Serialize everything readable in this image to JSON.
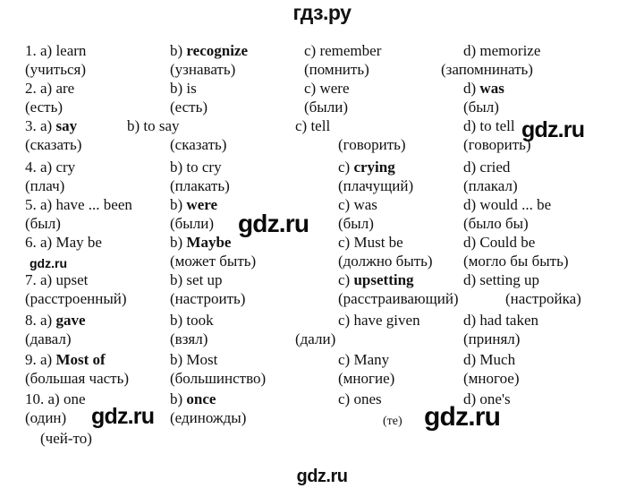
{
  "site": {
    "header_logo": "гдз.ру",
    "footer_logo": "gdz.ru",
    "watermarks": [
      {
        "id": "wm-a",
        "text": "gdz.ru"
      },
      {
        "id": "wm-b",
        "text": "gdz.ru"
      },
      {
        "id": "wm-c",
        "text": "gdz.ru"
      },
      {
        "id": "wm-d",
        "text": "gdz.ru"
      },
      {
        "id": "wm-e",
        "text": "gdz.ru"
      }
    ]
  },
  "exercise": {
    "items": [
      {
        "number": "1.",
        "options": [
          {
            "letter": "a)",
            "word": "learn",
            "bold": false,
            "translation": "(учиться)"
          },
          {
            "letter": "b)",
            "word": "recognize",
            "bold": true,
            "translation": "(узнавать)"
          },
          {
            "letter": "c)",
            "word": "remember",
            "bold": false,
            "translation": "(помнить)"
          },
          {
            "letter": "d)",
            "word": "memorize",
            "bold": false,
            "translation": "(запомнинать)"
          }
        ]
      },
      {
        "number": "2.",
        "options": [
          {
            "letter": "a)",
            "word": "are",
            "bold": false,
            "translation": "(есть)"
          },
          {
            "letter": "b)",
            "word": "is",
            "bold": false,
            "translation": "(есть)"
          },
          {
            "letter": "c)",
            "word": "were",
            "bold": false,
            "translation": "(были)"
          },
          {
            "letter": "d)",
            "word": "was",
            "bold": true,
            "translation": "(был)"
          }
        ]
      },
      {
        "number": "3.",
        "options": [
          {
            "letter": "a)",
            "word": "say",
            "bold": true,
            "translation": "(сказать)"
          },
          {
            "letter": "b)",
            "word": "to say",
            "bold": false,
            "translation": "(сказать)"
          },
          {
            "letter": "c)",
            "word": "tell",
            "bold": false,
            "translation": "(говорить)"
          },
          {
            "letter": "d)",
            "word": "to tell",
            "bold": false,
            "translation": "(говорить)"
          }
        ]
      },
      {
        "number": "4.",
        "options": [
          {
            "letter": "a)",
            "word": "cry",
            "bold": false,
            "translation": "(плач)"
          },
          {
            "letter": "b)",
            "word": "to cry",
            "bold": false,
            "translation": "(плакать)"
          },
          {
            "letter": "c)",
            "word": "crying",
            "bold": true,
            "translation": "(плачущий)"
          },
          {
            "letter": "d)",
            "word": "cried",
            "bold": false,
            "translation": "(плакал)"
          }
        ]
      },
      {
        "number": "5.",
        "options": [
          {
            "letter": "a)",
            "word": "have ... been",
            "bold": false,
            "translation": "(был)"
          },
          {
            "letter": "b)",
            "word": "were",
            "bold": true,
            "translation": "(были)"
          },
          {
            "letter": "c)",
            "word": "was",
            "bold": false,
            "translation": "(был)"
          },
          {
            "letter": "d)",
            "word": "would ... be",
            "bold": false,
            "translation": "(было бы)"
          }
        ]
      },
      {
        "number": "6.",
        "options": [
          {
            "letter": "a)",
            "word": "May be",
            "bold": false,
            "translation": ""
          },
          {
            "letter": "b)",
            "word": "Maybe",
            "bold": true,
            "translation": "(может быть)"
          },
          {
            "letter": "c)",
            "word": "Must be",
            "bold": false,
            "translation": "(должно быть)"
          },
          {
            "letter": "d)",
            "word": "Could be",
            "bold": false,
            "translation": "(могло бы быть)"
          }
        ]
      },
      {
        "number": "7.",
        "options": [
          {
            "letter": "a)",
            "word": "upset",
            "bold": false,
            "translation": "(расстроенный)"
          },
          {
            "letter": "b)",
            "word": "set up",
            "bold": false,
            "translation": "(настроить)"
          },
          {
            "letter": "c)",
            "word": "upsetting",
            "bold": true,
            "translation": "(расстраивающий)"
          },
          {
            "letter": "d)",
            "word": "setting up",
            "bold": false,
            "translation": "(настройка)"
          }
        ]
      },
      {
        "number": "8.",
        "options": [
          {
            "letter": "a)",
            "word": "gave",
            "bold": true,
            "translation": "(давал)"
          },
          {
            "letter": "b)",
            "word": "took",
            "bold": false,
            "translation": "(взял)"
          },
          {
            "letter": "c)",
            "word": "have given",
            "bold": false,
            "translation": "(дали)"
          },
          {
            "letter": "d)",
            "word": "had taken",
            "bold": false,
            "translation": "(принял)"
          }
        ]
      },
      {
        "number": "9.",
        "options": [
          {
            "letter": "a)",
            "word": "Most of",
            "bold": true,
            "translation": "(большая часть)"
          },
          {
            "letter": "b)",
            "word": "Most",
            "bold": false,
            "translation": "(большинство)"
          },
          {
            "letter": "c)",
            "word": "Many",
            "bold": false,
            "translation": "(многие)"
          },
          {
            "letter": "d)",
            "word": "Much",
            "bold": false,
            "translation": "(многое)"
          }
        ]
      },
      {
        "number": "10.",
        "options": [
          {
            "letter": "a)",
            "word": "one",
            "bold": false,
            "translation": "(один)"
          },
          {
            "letter": "b)",
            "word": "once",
            "bold": true,
            "translation": "(единожды)"
          },
          {
            "letter": "c)",
            "word": "ones",
            "bold": false,
            "translation": "(те)"
          },
          {
            "letter": "d)",
            "word": "one's",
            "bold": false,
            "translation": "(чей-то)"
          }
        ]
      }
    ]
  },
  "lines": {
    "l01": "1. a) learn",
    "l02": "b) recognize",
    "l03": "c) remember",
    "l04": "d) memorize",
    "l05": "(учиться)",
    "l06": "(узнавать)",
    "l07": "(помнить)",
    "l08": "(запомнинать)",
    "l09": "2. a) are",
    "l10": "b) is",
    "l11": "c) were",
    "l12": "d) was",
    "l13": "(есть)",
    "l14": "(есть)",
    "l15": "(были)",
    "l16": "(был)",
    "l17": "3. a) say",
    "l18": "b) to say",
    "l19": "c) tell",
    "l20": "d) to tell",
    "l21": "(сказать)",
    "l22": "(сказать)",
    "l23": "(говорить)",
    "l24": "(говорить)",
    "l25": "4. a) cry",
    "l26": "b) to cry",
    "l27": "c) crying",
    "l28": "d) cried",
    "l29": "(плач)",
    "l30": "(плакать)",
    "l31": "(плачущий)",
    "l32": "(плакал)",
    "l33": "5. a) have ... been",
    "l34": "b) were",
    "l35": "c) was",
    "l36": "d) would ... be",
    "l37": "(был)",
    "l38": "(были)",
    "l39": "(был)",
    "l40": "(было бы)",
    "l41": "6. a) May be",
    "l42": "b) Maybe",
    "l43": "c) Must be",
    "l44": "d) Could be",
    "l45": "(может быть)",
    "l46": "(должно быть)",
    "l47": "(могло бы быть)",
    "l48": "7. a) upset",
    "l49": "b) set up",
    "l50": "c) upsetting",
    "l51": "d) setting up",
    "l52": "(расстроенный)",
    "l53": "(настроить)",
    "l54": "(расстраивающий)",
    "l55": "(настройка)",
    "l56": "8. a) gave",
    "l57": "b) took",
    "l58": "c) have given",
    "l59": "d) had taken",
    "l60": "(давал)",
    "l61": "(взял)",
    "l62": "(дали)",
    "l63": "(принял)",
    "l64": "9. a) Most of",
    "l65": "b) Most",
    "l66": "c) Many",
    "l67": "d) Much",
    "l68": "(большая часть)",
    "l69": "(большинство)",
    "l70": "(многие)",
    "l71": "(многое)",
    "l72": "10. a) one",
    "l73": "b) once",
    "l74": "c) ones",
    "l75": "d) one's",
    "l76": "(один)",
    "l77": "(единожды)",
    "l78": "(те)",
    "l79": "(чей-то)"
  }
}
